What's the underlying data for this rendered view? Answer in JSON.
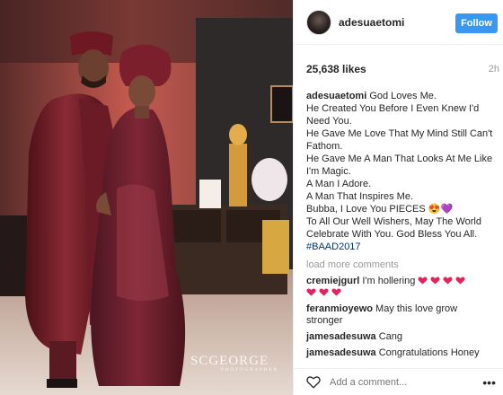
{
  "post": {
    "username": "adesuaetomi",
    "follow_label": "Follow",
    "likes": "25,638 likes",
    "time": "2h"
  },
  "photo": {
    "watermark_main": "SCGEORGE",
    "watermark_sub": "PHOTOGRAPHER"
  },
  "caption": {
    "user": "adesuaetomi",
    "lines": [
      "God Loves Me.",
      "He Created You Before I Even Knew I'd Need You.",
      "He Gave Me Love That My Mind Still Can't Fathom.",
      "He Gave Me A Man That Looks At Me Like I'm Magic.",
      "A Man I Adore.",
      "A Man That Inspires Me.",
      "Bubba, I Love You PIECES 😍💜",
      "To All Our Well Wishers, May The World Celebrate With You. God Bless You All."
    ],
    "hashtag": "#BAAD2017"
  },
  "load_more": "load more comments",
  "comments": [
    {
      "user": "cremiejgurl",
      "text": "I'm hollering"
    },
    {
      "user": "feranmioyewo",
      "text": "May this love grow stronger"
    },
    {
      "user": "jamesadesuwa",
      "text": "Cang"
    },
    {
      "user": "jamesadesuwa",
      "text": "Congratulations Honey"
    }
  ],
  "add_comment_placeholder": "Add a comment...",
  "more_label": "•••",
  "colors": {
    "follow_blue": "#3897f0",
    "hashtag": "#003569",
    "heart_red": "#e0245e",
    "attire_wine": "#7a1f2b"
  },
  "icons": {
    "avatar": "avatar",
    "like": "heart-outline-icon",
    "more": "more-options-icon",
    "emoji_heart": "red-heart-emoji"
  }
}
